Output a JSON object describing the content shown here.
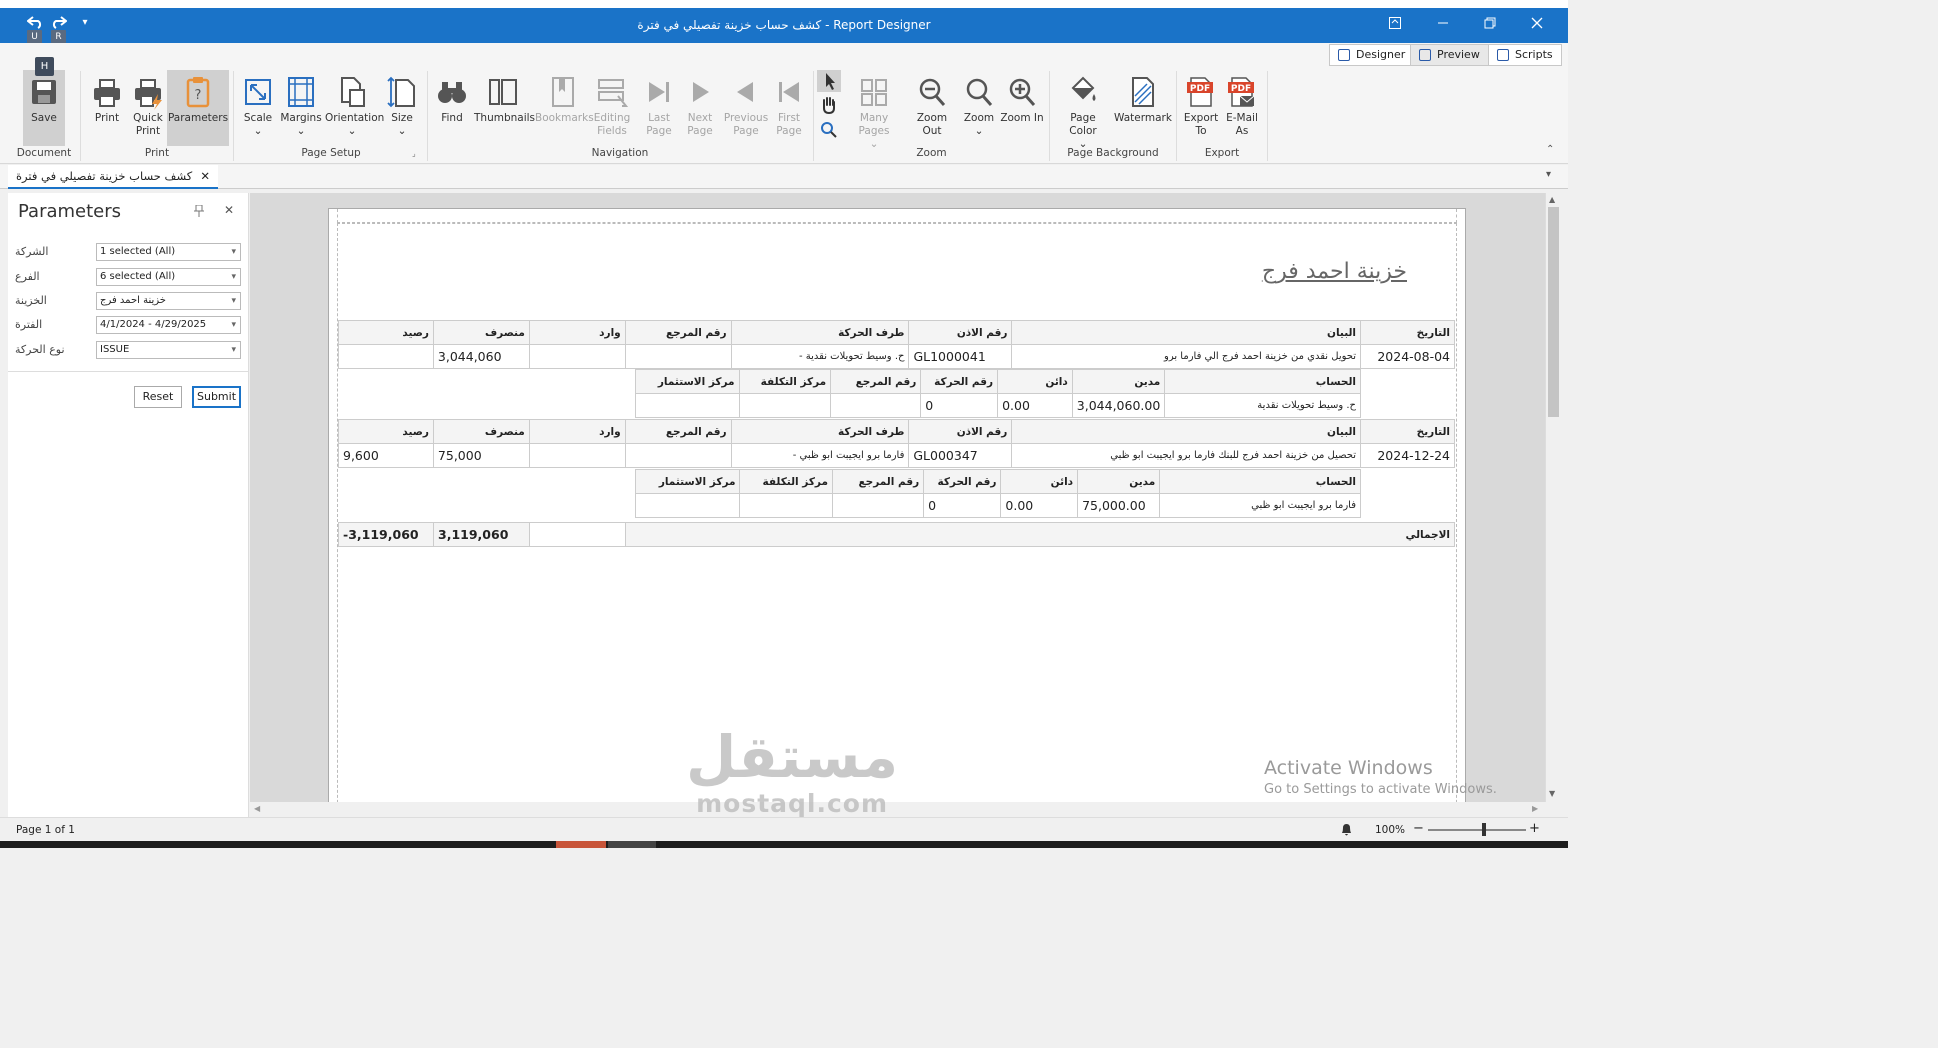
{
  "window": {
    "title": "كشف حساب خزينة تفصيلي في فترة - Report Designer",
    "undo_badge": "U",
    "redo_badge": "R",
    "keytip": "H"
  },
  "views": [
    {
      "label": "Designer"
    },
    {
      "label": "Preview"
    },
    {
      "label": "Scripts"
    }
  ],
  "ribbon": {
    "buttons": {
      "save": "Save",
      "print": "Print",
      "quick_print": "Quick Print",
      "parameters": "Parameters",
      "scale": "Scale",
      "margins": "Margins",
      "orientation": "Orientation",
      "size": "Size",
      "find": "Find",
      "thumbnails": "Thumbnails",
      "bookmarks": "Bookmarks",
      "editing_fields": "Editing Fields",
      "last_page": "Last Page",
      "next_page": "Next Page",
      "previous_page": "Previous Page",
      "first_page": "First Page",
      "many_pages": "Many Pages",
      "zoom_out": "Zoom Out",
      "zoom": "Zoom",
      "zoom_in": "Zoom In",
      "page_color": "Page Color",
      "watermark": "Watermark",
      "export_to": "Export To",
      "email_as": "E-Mail As"
    },
    "groups": {
      "document": "Document",
      "print": "Print",
      "page_setup": "Page Setup",
      "navigation": "Navigation",
      "zoom": "Zoom",
      "page_background": "Page Background",
      "export": "Export"
    }
  },
  "doc_tab": {
    "label": "كشف حساب خزينة تفصيلي في فترة"
  },
  "parameters": {
    "title": "Parameters",
    "fields": [
      {
        "label": "الشركة",
        "value": "1 selected (All)"
      },
      {
        "label": "الفرع",
        "value": "6 selected (All)"
      },
      {
        "label": "الخزينة",
        "value": "خزينة احمد فرج"
      },
      {
        "label": "الفترة",
        "value": "4/1/2024 - 4/29/2025"
      },
      {
        "label": "نوع الحركة",
        "value": "ISSUE"
      }
    ],
    "reset": "Reset",
    "submit": "Submit"
  },
  "report": {
    "title": "خزينة احمد فرج",
    "headers": {
      "date": "التاريخ",
      "statement": "البيان",
      "doc_no": "رقم الاذن",
      "party": "طرف الحركة",
      "ref_no": "رقم المرجع",
      "incoming": "وارد",
      "outgoing": "منصرف",
      "balance": "رصيد"
    },
    "detail_headers": {
      "account": "الحساب",
      "debit": "مدين",
      "credit": "دائن",
      "move_no": "رقم الحركة",
      "ref_no": "رقم المرجع",
      "cost_center": "مركز التكلفة",
      "investment_center": "مركز الاستثمار"
    },
    "entries": [
      {
        "date": "2024-08-04",
        "statement": "تحويل نقدي من خزينة احمد فرج الي فارما برو",
        "doc_no": "GL1000041",
        "party": "ح. وسيط تحويلات نقدية -",
        "ref_no": "",
        "incoming": "",
        "outgoing": "3,044,060",
        "balance": "",
        "detail": {
          "account": "ح. وسيط تحويلات نقدية",
          "debit": "3,044,060.00",
          "credit": "0.00",
          "move_no": "0",
          "ref_no": "",
          "cost_center": "",
          "investment_center": ""
        }
      },
      {
        "date": "2024-12-24",
        "statement": "تحصيل من خزينة احمد فرج للبنك فارما برو ايجيبت ابو ظبي",
        "doc_no": "GL000347",
        "party": "فارما برو ايجيبت ابو ظبي -",
        "ref_no": "",
        "incoming": "",
        "outgoing": "75,000",
        "balance": "9,600",
        "detail": {
          "account": "فارما برو ايجيبت ابو ظبي",
          "debit": "75,000.00",
          "credit": "0.00",
          "move_no": "0",
          "ref_no": "",
          "cost_center": "",
          "investment_center": ""
        }
      }
    ],
    "total": {
      "label": "الاجمالي",
      "outgoing": "3,119,060",
      "balance": "3,119,060-"
    }
  },
  "status": {
    "page": "Page 1 of 1",
    "zoom": "100%"
  },
  "activate_windows": {
    "line1": "Activate Windows",
    "line2": "Go to Settings to activate Windows."
  },
  "watermark": {
    "arabic": "مستقل",
    "latin": "mostaql.com"
  },
  "colors": {
    "titlebar": "#1a73c8",
    "parameters_selected": "#d0d0d0",
    "accent_orange": "#e8913a",
    "pdf_red": "#d9452b"
  }
}
